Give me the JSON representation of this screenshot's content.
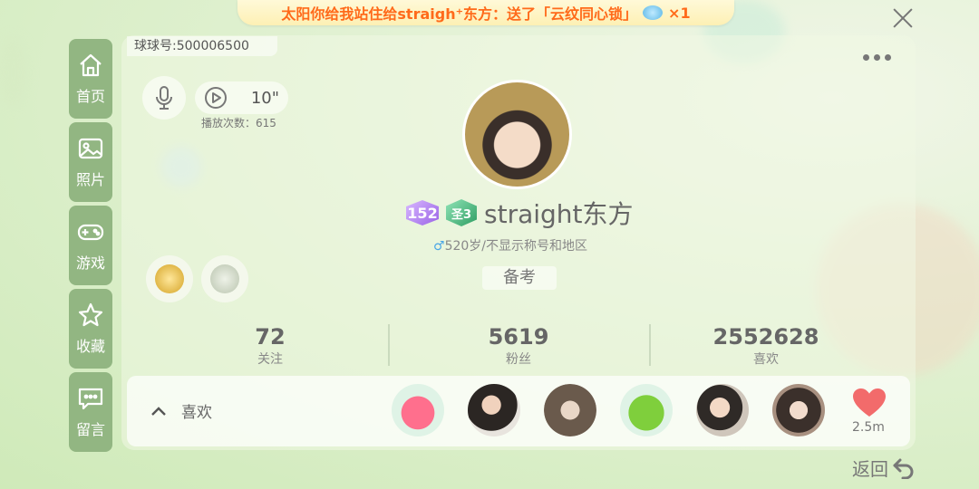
{
  "banner": {
    "text": "太阳你给我站住给straigh⁺东方：送了「云纹同心锁」",
    "count": "×1"
  },
  "nav": [
    {
      "label": "首页",
      "icon": "home-icon"
    },
    {
      "label": "照片",
      "icon": "photo-icon"
    },
    {
      "label": "游戏",
      "icon": "gamepad-icon"
    },
    {
      "label": "收藏",
      "icon": "star-icon"
    },
    {
      "label": "留言",
      "icon": "message-icon"
    }
  ],
  "profile": {
    "uid_label": "球球号:500006500",
    "voice_duration": "10\"",
    "play_count": "播放次数：615",
    "level": "152",
    "rank_badge": "圣3",
    "username": "straight东方",
    "gender_symbol": "♂",
    "info": "520岁/不显示称号和地区",
    "tag": "备考"
  },
  "stats": [
    {
      "value": "72",
      "label": "关注"
    },
    {
      "value": "5619",
      "label": "粉丝"
    },
    {
      "value": "2552628",
      "label": "喜欢"
    }
  ],
  "likes": {
    "label": "喜欢",
    "count": "2.5m"
  },
  "footer": {
    "back_label": "返回"
  },
  "colors": {
    "nav_bg": "#92b682",
    "banner_text": "#ff6a1a",
    "heart": "#f26b6b"
  }
}
